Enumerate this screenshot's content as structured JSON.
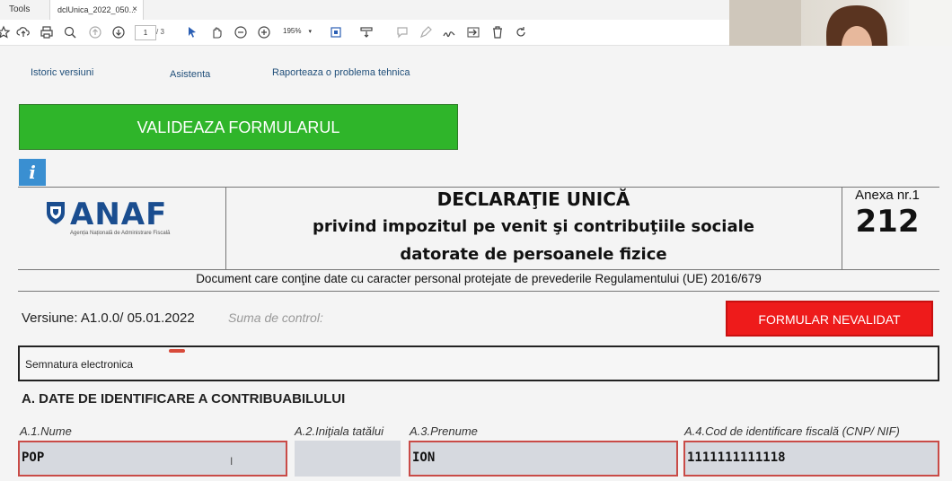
{
  "tabs": {
    "tools": "Tools",
    "document": "dclUnica_2022_050...",
    "close": "×"
  },
  "toolbar": {
    "page_current": "1",
    "page_total": "/ 3",
    "zoom": "195%",
    "icons": [
      "star-icon",
      "upload-icon",
      "print-icon",
      "zoom-out-search-icon",
      "page-up-icon",
      "page-down-icon",
      "select-arrow-icon",
      "hand-icon",
      "zoom-out-icon",
      "zoom-in-icon",
      "fit-page-icon",
      "scroll-icon",
      "comment-icon",
      "pen-icon",
      "sign-icon",
      "share-icon",
      "delete-icon",
      "rotate-icon"
    ]
  },
  "links": {
    "history": "Istoric versiuni",
    "help": "Asistenta",
    "report": "Raporteaza o problema tehnica"
  },
  "validate_button": "VALIDEAZA FORMULARUL",
  "info_icon": "i",
  "logo": {
    "name": "ANAF",
    "subtitle": "Agenția Națională de Administrare Fiscală"
  },
  "title": {
    "line1": "DECLARAŢIE UNICĂ",
    "line2": "privind impozitul pe venit şi contribuţiile sociale",
    "line3": "datorate de persoanele fizice"
  },
  "annex": {
    "label": "Anexa nr.1",
    "number": "212"
  },
  "gdpr_notice": "Document care conţine date cu caracter personal protejate de prevederile Regulamentului (UE) 2016/679",
  "version": "Versiune:  A1.0.0/ 05.01.2022",
  "checksum_label": "Suma de  control:",
  "invalid_button": "FORMULAR NEVALIDAT",
  "signature_label": "Semnatura electronica",
  "section_a": "A. DATE DE IDENTIFICARE A CONTRIBUABILULUI",
  "fields": {
    "name_label": "A.1.Nume",
    "name_value": "POP",
    "initial_label": "A.2.Iniţiala tatălui",
    "initial_value": "",
    "firstname_label": "A.3.Prenume",
    "firstname_value": "ION",
    "cnp_label": "A.4.Cod de identificare fiscală (CNP/ NIF)",
    "cnp_value": "1111111111118"
  },
  "colors": {
    "validate_green": "#2fb52a",
    "invalid_red": "#ee1b1b",
    "field_border": "#c94b47",
    "anaf_blue": "#1a4d8f",
    "info_blue": "#3a8fd1"
  }
}
